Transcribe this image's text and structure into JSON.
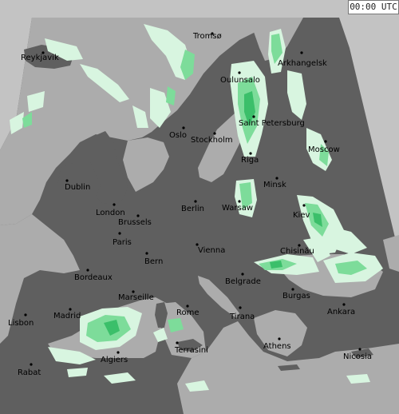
{
  "timestamp": "00:00 UTC",
  "colors": {
    "outside_domain": "#c3c3c3",
    "land": "#5f5f5f",
    "sea": "#acacac",
    "precip_light": "#d8f5e0",
    "precip_moderate": "#7ddc9a",
    "precip_heavy": "#3bbf6a",
    "city_dot": "#000000"
  },
  "cities": [
    "Tromsø",
    "Reykjavik",
    "Arkhangelsk",
    "Oulunsalo",
    "Oslo",
    "Stockholm",
    "Saint Petersburg",
    "Moscow",
    "Riga",
    "Dublin",
    "Minsk",
    "London",
    "Berlin",
    "Warsaw",
    "Kiev",
    "Brussels",
    "Paris",
    "Chisinău",
    "Bern",
    "Vienna",
    "Bordeaux",
    "Belgrade",
    "Marseille",
    "Burgas",
    "Ankara",
    "Lisbon",
    "Madrid",
    "Rome",
    "Tirana",
    "Athens",
    "Terrasini",
    "Algiers",
    "Nicosia",
    "Rabat"
  ]
}
